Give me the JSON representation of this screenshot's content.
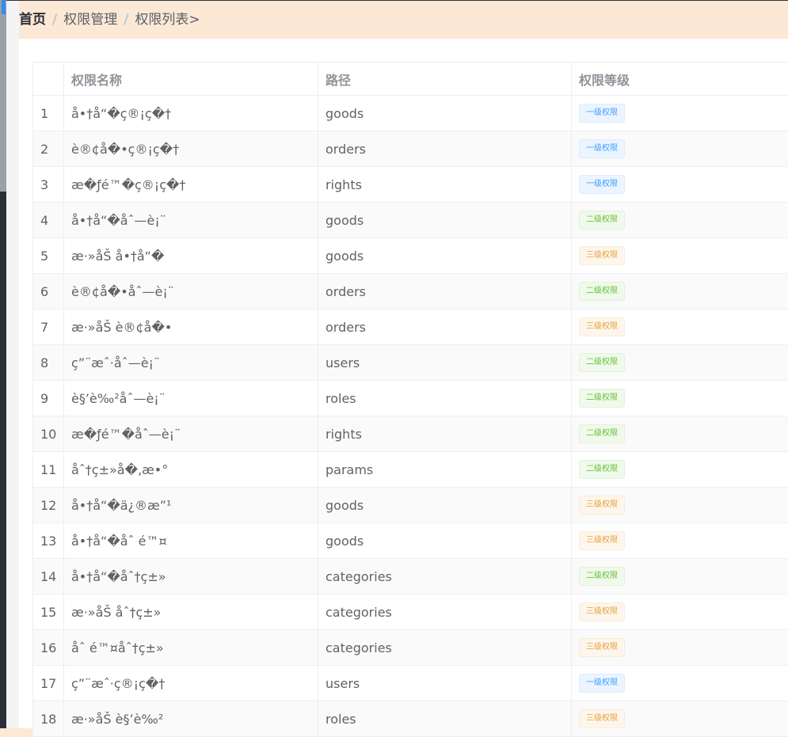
{
  "breadcrumb": {
    "home": "首页",
    "separator": "/",
    "level1": "权限管理",
    "level2": "权限列表>"
  },
  "table": {
    "headers": {
      "index": "",
      "name": "权限名称",
      "path": "路径",
      "level": "权限等级"
    },
    "level_labels": {
      "0": "一级权限",
      "1": "二级权限",
      "2": "三级权限"
    },
    "rows": [
      {
        "index": "1",
        "name": "å•†å“�ç®¡ç�†",
        "path": "goods",
        "level": "一级权限"
      },
      {
        "index": "2",
        "name": "è®¢å�•ç®¡ç�†",
        "path": "orders",
        "level": "一级权限"
      },
      {
        "index": "3",
        "name": "æ�ƒé™�ç®¡ç�†",
        "path": "rights",
        "level": "一级权限"
      },
      {
        "index": "4",
        "name": "å•†å“�åˆ—è¡¨",
        "path": "goods",
        "level": "二级权限"
      },
      {
        "index": "5",
        "name": "æ·»åŠ å•†å“�",
        "path": "goods",
        "level": "三级权限"
      },
      {
        "index": "6",
        "name": "è®¢å�•åˆ—è¡¨",
        "path": "orders",
        "level": "二级权限"
      },
      {
        "index": "7",
        "name": "æ·»åŠ è®¢å�•",
        "path": "orders",
        "level": "三级权限"
      },
      {
        "index": "8",
        "name": "ç”¨æˆ·åˆ—è¡¨",
        "path": "users",
        "level": "二级权限"
      },
      {
        "index": "9",
        "name": "è§’è‰²åˆ—è¡¨",
        "path": "roles",
        "level": "二级权限"
      },
      {
        "index": "10",
        "name": "æ�ƒé™�åˆ—è¡¨",
        "path": "rights",
        "level": "二级权限"
      },
      {
        "index": "11",
        "name": "åˆ†ç±»å�‚æ•°",
        "path": "params",
        "level": "二级权限"
      },
      {
        "index": "12",
        "name": "å•†å“�ä¿®æ”¹",
        "path": "goods",
        "level": "三级权限"
      },
      {
        "index": "13",
        "name": "å•†å“�åˆ é™¤",
        "path": "goods",
        "level": "三级权限"
      },
      {
        "index": "14",
        "name": "å•†å“�åˆ†ç±»",
        "path": "categories",
        "level": "二级权限"
      },
      {
        "index": "15",
        "name": "æ·»åŠ åˆ†ç±»",
        "path": "categories",
        "level": "三级权限"
      },
      {
        "index": "16",
        "name": "åˆ é™¤åˆ†ç±»",
        "path": "categories",
        "level": "三级权限"
      },
      {
        "index": "17",
        "name": "ç”¨æˆ·ç®¡ç�†",
        "path": "users",
        "level": "一级权限"
      },
      {
        "index": "18",
        "name": "æ·»åŠ è§’è‰²",
        "path": "roles",
        "level": "三级权限"
      }
    ]
  },
  "colors": {
    "breadcrumb_bg": "#fbe9d6",
    "tag_level1": "#409eff",
    "tag_level2": "#67c23a",
    "tag_level3": "#e6a23c"
  }
}
